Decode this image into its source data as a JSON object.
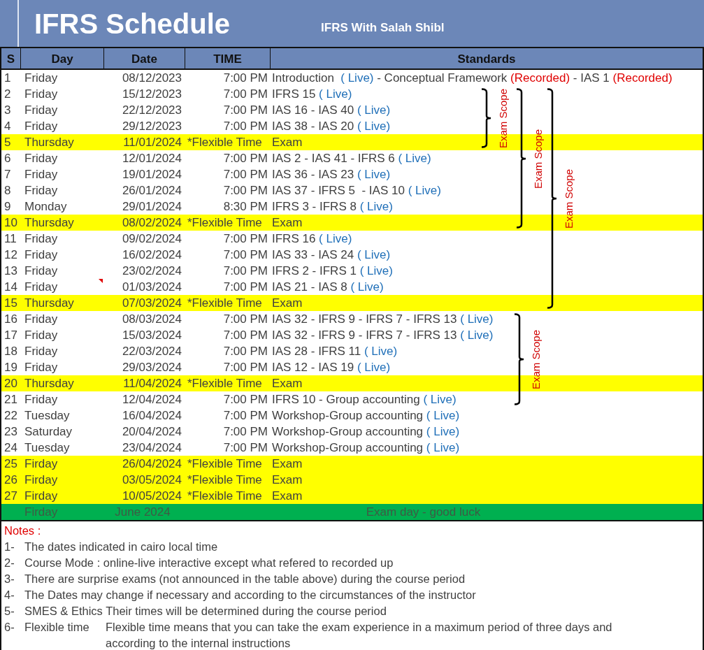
{
  "header": {
    "title": "IFRS Schedule",
    "subtitle": "IFRS With Salah Shibl"
  },
  "columns": [
    "S",
    "Day",
    "Date",
    "TIME",
    "Standards"
  ],
  "rows": [
    {
      "kind": "session",
      "s": "1",
      "day": "Friday",
      "date": "08/12/2023",
      "time": "7:00 PM",
      "comment": false,
      "standards": [
        {
          "kind": "plain",
          "text": "Introduction  "
        },
        {
          "kind": "live",
          "text": "( Live)"
        },
        {
          "kind": "plain",
          "text": " - Conceptual Framework "
        },
        {
          "kind": "recorded",
          "text": "(Recorded)"
        },
        {
          "kind": "plain",
          "text": " - IAS 1 "
        },
        {
          "kind": "recorded",
          "text": "(Recorded)"
        }
      ]
    },
    {
      "kind": "session",
      "s": "2",
      "day": "Friday",
      "date": "15/12/2023",
      "time": "7:00 PM",
      "comment": false,
      "standards": [
        {
          "kind": "plain",
          "text": "IFRS 15 "
        },
        {
          "kind": "live",
          "text": "( Live)"
        }
      ]
    },
    {
      "kind": "session",
      "s": "3",
      "day": "Friday",
      "date": "22/12/2023",
      "time": "7:00 PM",
      "comment": false,
      "standards": [
        {
          "kind": "plain",
          "text": "IAS 16 - IAS 40 "
        },
        {
          "kind": "live",
          "text": "( Live)"
        }
      ]
    },
    {
      "kind": "session",
      "s": "4",
      "day": "Friday",
      "date": "29/12/2023",
      "time": "7:00 PM",
      "comment": false,
      "standards": [
        {
          "kind": "plain",
          "text": "IAS 38 - IAS 20 "
        },
        {
          "kind": "live",
          "text": "( Live)"
        }
      ]
    },
    {
      "kind": "exam",
      "s": "5",
      "day": "Thursday",
      "date": "11/01/2024",
      "time": "*Flexible Time",
      "comment": false,
      "standards": [
        {
          "kind": "plain",
          "text": "Exam"
        }
      ]
    },
    {
      "kind": "session",
      "s": "6",
      "day": "Friday",
      "date": "12/01/2024",
      "time": "7:00 PM",
      "comment": false,
      "standards": [
        {
          "kind": "plain",
          "text": "IAS 2 - IAS 41 - IFRS 6 "
        },
        {
          "kind": "live",
          "text": "( Live)"
        }
      ]
    },
    {
      "kind": "session",
      "s": "7",
      "day": "Friday",
      "date": "19/01/2024",
      "time": "7:00 PM",
      "comment": false,
      "standards": [
        {
          "kind": "plain",
          "text": "IAS 36 - IAS 23 "
        },
        {
          "kind": "live",
          "text": "( Live)"
        }
      ]
    },
    {
      "kind": "session",
      "s": "8",
      "day": "Friday",
      "date": "26/01/2024",
      "time": "7:00 PM",
      "comment": false,
      "standards": [
        {
          "kind": "plain",
          "text": "IAS 37 - IFRS 5  - IAS 10 "
        },
        {
          "kind": "live",
          "text": "( Live)"
        }
      ]
    },
    {
      "kind": "session",
      "s": "9",
      "day": "Monday",
      "date": "29/01/2024",
      "time": "8:30 PM",
      "comment": false,
      "standards": [
        {
          "kind": "plain",
          "text": "IFRS 3 - IFRS 8 "
        },
        {
          "kind": "live",
          "text": "( Live)"
        }
      ]
    },
    {
      "kind": "exam",
      "s": "10",
      "day": "Thursday",
      "date": "08/02/2024",
      "time": "*Flexible Time",
      "comment": false,
      "standards": [
        {
          "kind": "plain",
          "text": "Exam"
        }
      ]
    },
    {
      "kind": "session",
      "s": "11",
      "day": "Friday",
      "date": "09/02/2024",
      "time": "7:00 PM",
      "comment": false,
      "standards": [
        {
          "kind": "plain",
          "text": "IFRS 16 "
        },
        {
          "kind": "live",
          "text": "( Live)"
        }
      ]
    },
    {
      "kind": "session",
      "s": "12",
      "day": "Friday",
      "date": "16/02/2024",
      "time": "7:00 PM",
      "comment": false,
      "standards": [
        {
          "kind": "plain",
          "text": "IAS 33 - IAS 24 "
        },
        {
          "kind": "live",
          "text": "( Live)"
        }
      ]
    },
    {
      "kind": "session",
      "s": "13",
      "day": "Friday",
      "date": "23/02/2024",
      "time": "7:00 PM",
      "comment": false,
      "standards": [
        {
          "kind": "plain",
          "text": "IFRS 2 - IFRS 1 "
        },
        {
          "kind": "live",
          "text": "( Live)"
        }
      ]
    },
    {
      "kind": "session",
      "s": "14",
      "day": "Friday",
      "date": "01/03/2024",
      "time": "7:00 PM",
      "comment": true,
      "standards": [
        {
          "kind": "plain",
          "text": "IAS 21 - IAS 8 "
        },
        {
          "kind": "live",
          "text": "( Live)"
        }
      ]
    },
    {
      "kind": "exam",
      "s": "15",
      "day": "Thursday",
      "date": "07/03/2024",
      "time": "*Flexible Time",
      "comment": false,
      "standards": [
        {
          "kind": "plain",
          "text": "Exam"
        }
      ]
    },
    {
      "kind": "session",
      "s": "16",
      "day": "Friday",
      "date": "08/03/2024",
      "time": "7:00 PM",
      "comment": false,
      "standards": [
        {
          "kind": "plain",
          "text": "IAS 32 - IFRS 9 - IFRS 7 - IFRS 13 "
        },
        {
          "kind": "live",
          "text": "( Live)"
        }
      ]
    },
    {
      "kind": "session",
      "s": "17",
      "day": "Friday",
      "date": "15/03/2024",
      "time": "7:00 PM",
      "comment": false,
      "standards": [
        {
          "kind": "plain",
          "text": "IAS 32 - IFRS 9 - IFRS 7 - IFRS 13 "
        },
        {
          "kind": "live",
          "text": "( Live)"
        }
      ]
    },
    {
      "kind": "session",
      "s": "18",
      "day": "Friday",
      "date": "22/03/2024",
      "time": "7:00 PM",
      "comment": false,
      "standards": [
        {
          "kind": "plain",
          "text": "IAS 28 - IFRS 11 "
        },
        {
          "kind": "live",
          "text": "( Live)"
        }
      ]
    },
    {
      "kind": "session",
      "s": "19",
      "day": "Friday",
      "date": "29/03/2024",
      "time": "7:00 PM",
      "comment": false,
      "standards": [
        {
          "kind": "plain",
          "text": "IAS 12 - IAS 19 "
        },
        {
          "kind": "live",
          "text": "( Live)"
        }
      ]
    },
    {
      "kind": "exam",
      "s": "20",
      "day": "Thursday",
      "date": "11/04/2024",
      "time": "*Flexible Time",
      "comment": false,
      "standards": [
        {
          "kind": "plain",
          "text": "Exam"
        }
      ]
    },
    {
      "kind": "session",
      "s": "21",
      "day": "Friday",
      "date": "12/04/2024",
      "time": "7:00 PM",
      "comment": false,
      "standards": [
        {
          "kind": "plain",
          "text": "IFRS 10 - Group accounting "
        },
        {
          "kind": "live",
          "text": "( Live)"
        }
      ]
    },
    {
      "kind": "session",
      "s": "22",
      "day": "Tuesday",
      "date": "16/04/2024",
      "time": "7:00 PM",
      "comment": false,
      "standards": [
        {
          "kind": "plain",
          "text": "Workshop-Group accounting "
        },
        {
          "kind": "live",
          "text": "( Live)"
        }
      ]
    },
    {
      "kind": "session",
      "s": "23",
      "day": "Saturday",
      "date": "20/04/2024",
      "time": "7:00 PM",
      "comment": false,
      "standards": [
        {
          "kind": "plain",
          "text": "Workshop-Group accounting "
        },
        {
          "kind": "live",
          "text": "( Live)"
        }
      ]
    },
    {
      "kind": "session",
      "s": "24",
      "day": "Tuesday",
      "date": "23/04/2024",
      "time": "7:00 PM",
      "comment": false,
      "standards": [
        {
          "kind": "plain",
          "text": "Workshop-Group accounting "
        },
        {
          "kind": "live",
          "text": "( Live)"
        }
      ]
    },
    {
      "kind": "exam",
      "s": "25",
      "day": "Firday",
      "date": "26/04/2024",
      "time": "*Flexible Time",
      "comment": false,
      "standards": [
        {
          "kind": "plain",
          "text": "Exam"
        }
      ]
    },
    {
      "kind": "exam",
      "s": "26",
      "day": "Firday",
      "date": "03/05/2024",
      "time": "*Flexible Time",
      "comment": false,
      "standards": [
        {
          "kind": "plain",
          "text": "Exam"
        }
      ]
    },
    {
      "kind": "exam",
      "s": "27",
      "day": "Firday",
      "date": "10/05/2024",
      "time": "*Flexible Time",
      "comment": false,
      "standards": [
        {
          "kind": "plain",
          "text": "Exam"
        }
      ]
    },
    {
      "kind": "final",
      "day": "Firday",
      "date": "June 2024",
      "comment": false,
      "standards": [
        {
          "kind": "plain",
          "text": "Exam day - good luck"
        }
      ]
    }
  ],
  "exam_scopes": [
    {
      "label": "Exam Scope"
    },
    {
      "label": "Exam Scope"
    },
    {
      "label": "Exam Scope"
    },
    {
      "label": "Exam Scope"
    }
  ],
  "notes": {
    "title": "Notes :",
    "items": [
      {
        "number": "1-",
        "text": "The dates indicated in cairo local time"
      },
      {
        "number": "2-",
        "text": "Course Mode : online-live interactive except what refered to recorded up"
      },
      {
        "number": "3-",
        "text": "There are surprise exams (not announced in the table above) during the course period"
      },
      {
        "number": "4-",
        "text": "The Dates may change if necessary and according to the circumstances of the instructor"
      },
      {
        "number": "5-",
        "text": "SMES & Ethics Their times will be determined during the course period"
      },
      {
        "number": "6-",
        "term": "Flexible time",
        "text": "Flexible time means that you can take the exam experience in a maximum period of three days and according to the internal instructions"
      }
    ]
  }
}
